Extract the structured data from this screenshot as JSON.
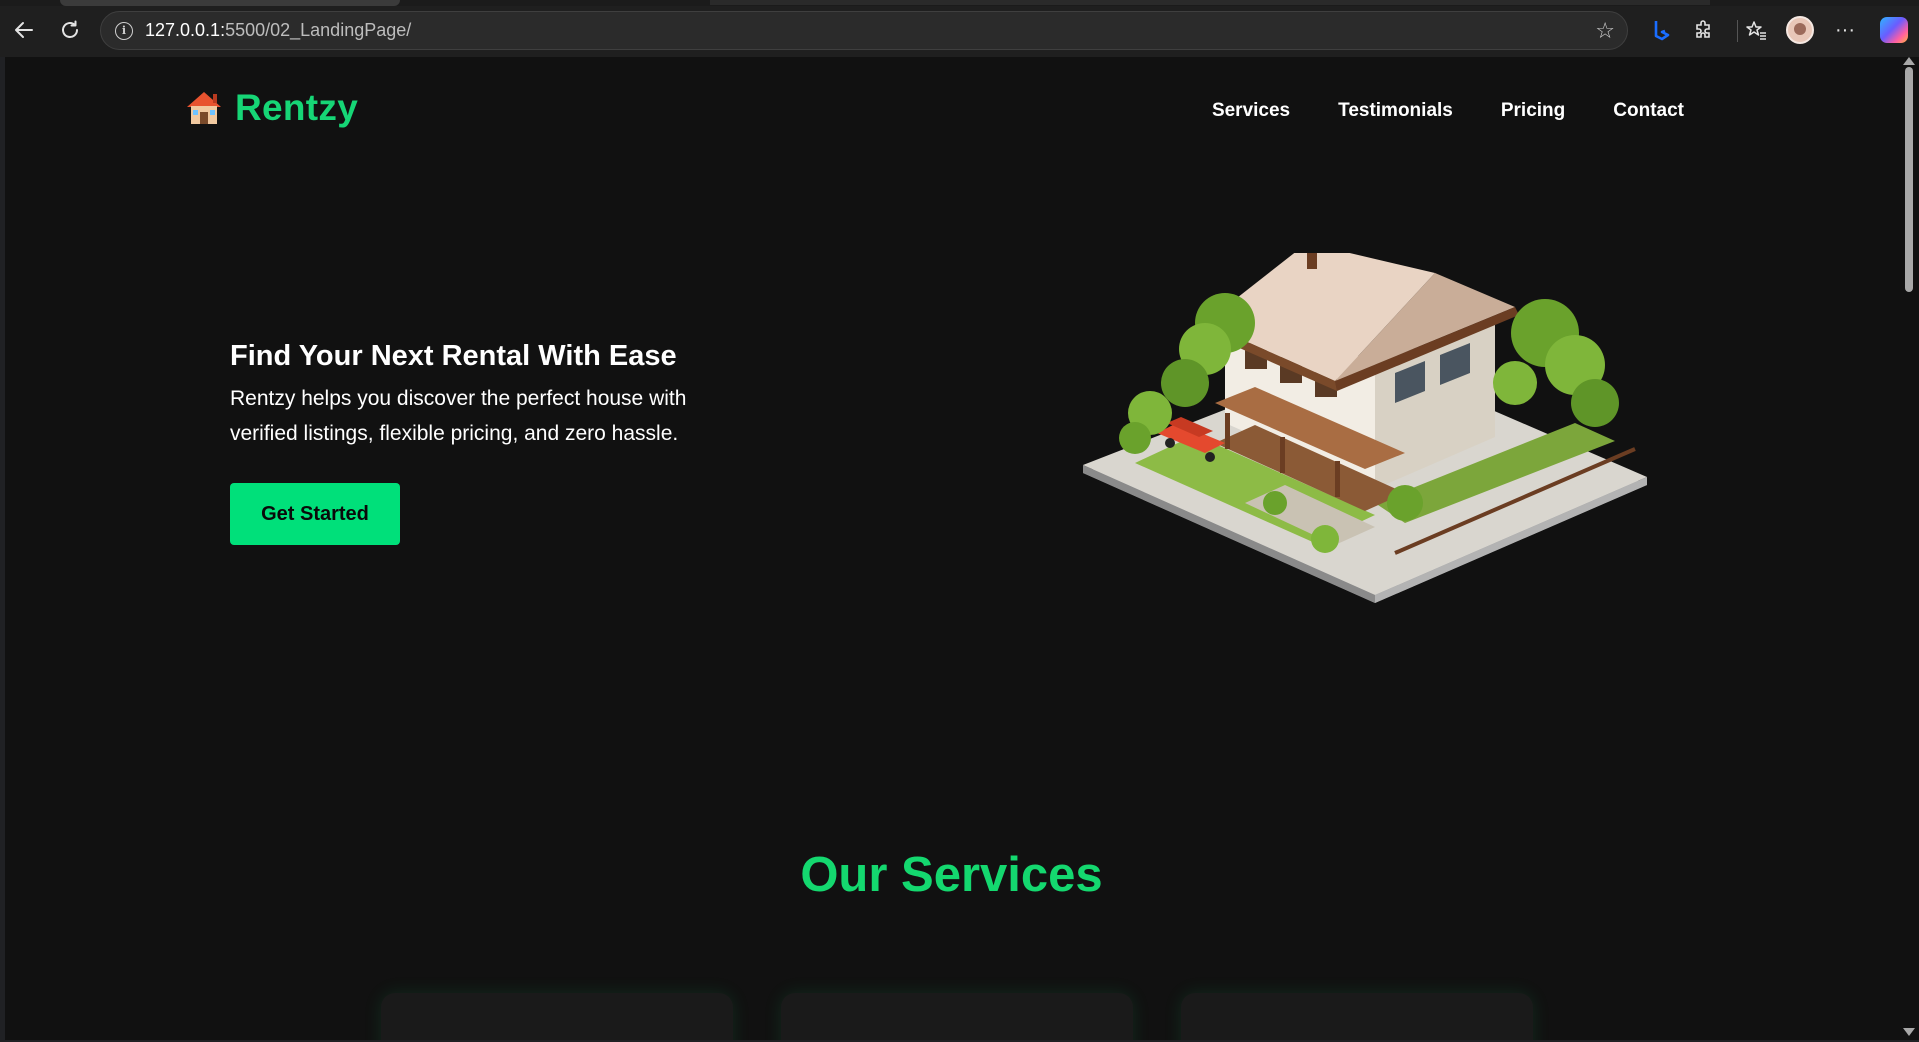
{
  "browser": {
    "url_host": "127.0.0.1:",
    "url_rest": "5500/02_LandingPage/"
  },
  "site": {
    "brand": "Rentzy",
    "nav": [
      "Services",
      "Testimonials",
      "Pricing",
      "Contact"
    ]
  },
  "hero": {
    "title": "Find Your Next Rental With Ease",
    "line1": "Rentzy helps you discover the perfect house with",
    "line2": "verified listings, flexible pricing, and zero hassle.",
    "cta": "Get Started"
  },
  "services": {
    "title": "Our Services",
    "card_count": 3
  },
  "colors": {
    "accent": "#16d676",
    "button": "#00e07a",
    "background": "#111111"
  }
}
